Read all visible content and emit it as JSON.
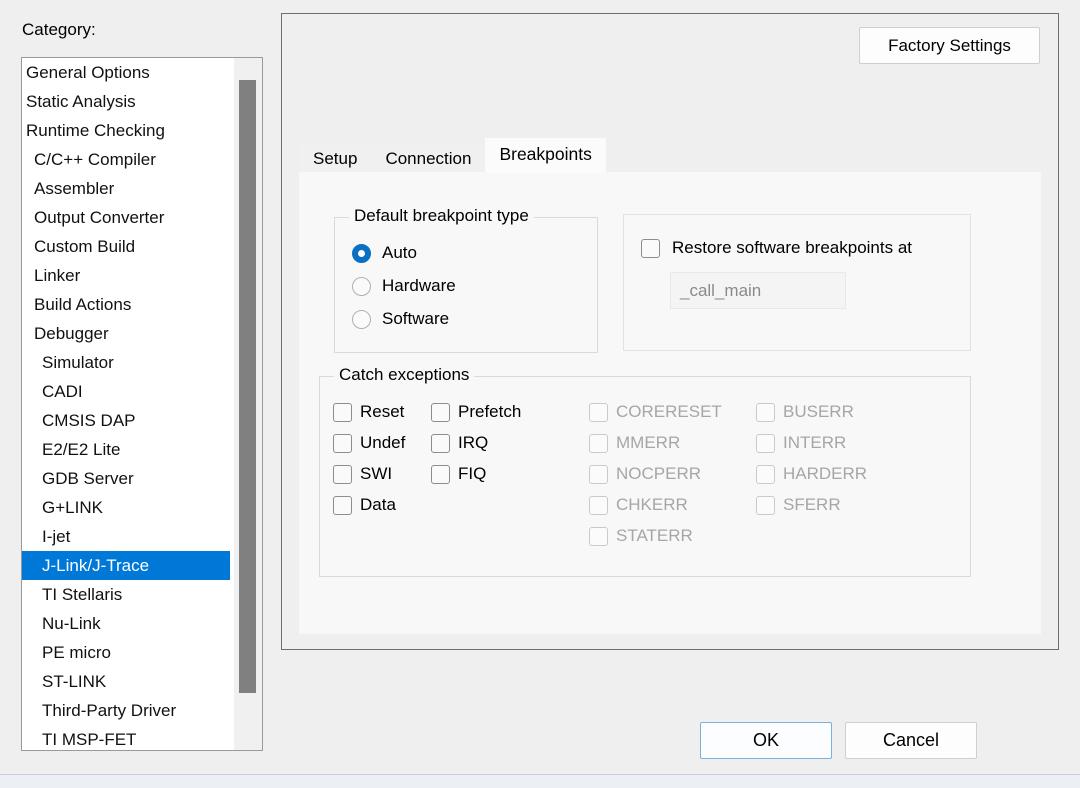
{
  "dialog": {
    "category_label": "Category:",
    "factory_settings_label": "Factory Settings",
    "ok_label": "OK",
    "cancel_label": "Cancel",
    "accent_color": "#0078d7",
    "selected_radio_color": "#0b6fc4"
  },
  "sidebar": {
    "items": [
      {
        "label": "General Options",
        "indent": 0,
        "selected": false
      },
      {
        "label": "Static Analysis",
        "indent": 0,
        "selected": false
      },
      {
        "label": "Runtime Checking",
        "indent": 0,
        "selected": false
      },
      {
        "label": "C/C++ Compiler",
        "indent": 1,
        "selected": false
      },
      {
        "label": "Assembler",
        "indent": 1,
        "selected": false
      },
      {
        "label": "Output Converter",
        "indent": 1,
        "selected": false
      },
      {
        "label": "Custom Build",
        "indent": 1,
        "selected": false
      },
      {
        "label": "Linker",
        "indent": 1,
        "selected": false
      },
      {
        "label": "Build Actions",
        "indent": 1,
        "selected": false
      },
      {
        "label": "Debugger",
        "indent": 1,
        "selected": false
      },
      {
        "label": "Simulator",
        "indent": 2,
        "selected": false
      },
      {
        "label": "CADI",
        "indent": 2,
        "selected": false
      },
      {
        "label": "CMSIS DAP",
        "indent": 2,
        "selected": false
      },
      {
        "label": "E2/E2 Lite",
        "indent": 2,
        "selected": false
      },
      {
        "label": "GDB Server",
        "indent": 2,
        "selected": false
      },
      {
        "label": "G+LINK",
        "indent": 2,
        "selected": false
      },
      {
        "label": "I-jet",
        "indent": 2,
        "selected": false
      },
      {
        "label": "J-Link/J-Trace",
        "indent": 2,
        "selected": true
      },
      {
        "label": "TI Stellaris",
        "indent": 2,
        "selected": false
      },
      {
        "label": "Nu-Link",
        "indent": 2,
        "selected": false
      },
      {
        "label": "PE micro",
        "indent": 2,
        "selected": false
      },
      {
        "label": "ST-LINK",
        "indent": 2,
        "selected": false
      },
      {
        "label": "Third-Party Driver",
        "indent": 2,
        "selected": false
      },
      {
        "label": "TI MSP-FET",
        "indent": 2,
        "selected": false
      }
    ]
  },
  "tabs": [
    {
      "label": "Setup",
      "active": false
    },
    {
      "label": "Connection",
      "active": false
    },
    {
      "label": "Breakpoints",
      "active": true
    }
  ],
  "breakpoints": {
    "default_type": {
      "title": "Default breakpoint type",
      "options": [
        {
          "label": "Auto",
          "checked": true
        },
        {
          "label": "Hardware",
          "checked": false
        },
        {
          "label": "Software",
          "checked": false
        }
      ]
    },
    "restore": {
      "checkbox_label": "Restore software breakpoints at",
      "checked": false,
      "location_value": "_call_main",
      "location_disabled": true
    },
    "catch_exceptions": {
      "title": "Catch exceptions",
      "column1": [
        {
          "label": "Reset",
          "checked": false,
          "disabled": false
        },
        {
          "label": "Undef",
          "checked": false,
          "disabled": false
        },
        {
          "label": "SWI",
          "checked": false,
          "disabled": false
        },
        {
          "label": "Data",
          "checked": false,
          "disabled": false
        }
      ],
      "column2": [
        {
          "label": "Prefetch",
          "checked": false,
          "disabled": false
        },
        {
          "label": "IRQ",
          "checked": false,
          "disabled": false
        },
        {
          "label": "FIQ",
          "checked": false,
          "disabled": false
        }
      ],
      "column3": [
        {
          "label": "CORERESET",
          "checked": false,
          "disabled": true
        },
        {
          "label": "MMERR",
          "checked": false,
          "disabled": true
        },
        {
          "label": "NOCPERR",
          "checked": false,
          "disabled": true
        },
        {
          "label": "CHKERR",
          "checked": false,
          "disabled": true
        },
        {
          "label": "STATERR",
          "checked": false,
          "disabled": true
        }
      ],
      "column4": [
        {
          "label": "BUSERR",
          "checked": false,
          "disabled": true
        },
        {
          "label": "INTERR",
          "checked": false,
          "disabled": true
        },
        {
          "label": "HARDERR",
          "checked": false,
          "disabled": true
        },
        {
          "label": "SFERR",
          "checked": false,
          "disabled": true
        }
      ]
    }
  }
}
